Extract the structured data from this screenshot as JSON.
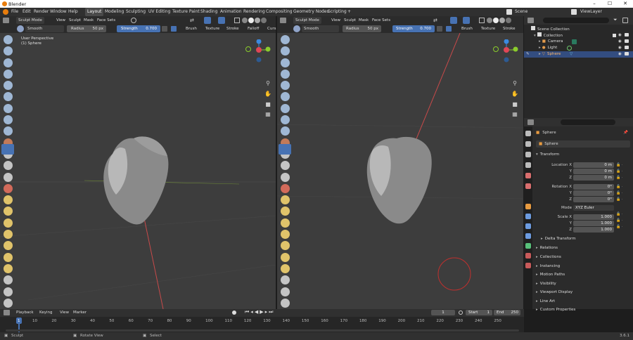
{
  "window": {
    "title": "Blender",
    "minimize": "–",
    "maximize": "☐",
    "close": "✕"
  },
  "menu": [
    "File",
    "Edit",
    "Render",
    "Window",
    "Help"
  ],
  "workspaces": [
    "Layout",
    "Modeling",
    "Sculpting",
    "UV Editing",
    "Texture Paint",
    "Shading",
    "Animation",
    "Rendering",
    "Compositing",
    "Geometry Nodes",
    "Scripting",
    "+"
  ],
  "active_workspace": "Layout",
  "scene": {
    "label": "Scene",
    "viewlayer": "ViewLayer"
  },
  "viewport_left": {
    "mode": "Sculpt Mode",
    "menus": [
      "View",
      "Sculpt",
      "Mask",
      "Face Sets"
    ],
    "brush_name": "Smooth",
    "radius_label": "Radius",
    "radius_value": "50 px",
    "strength_label": "Strength",
    "strength_value": "0.700",
    "dropdowns": [
      "Brush",
      "Texture",
      "Stroke",
      "Falloff",
      "Curs"
    ],
    "info_line1": "User Perspective",
    "info_line2": "(1) Sphere"
  },
  "viewport_right": {
    "mode": "Sculpt Mode",
    "menus": [
      "View",
      "Sculpt",
      "Mask",
      "Face Sets"
    ],
    "brush_name": "Smooth",
    "radius_label": "Radius",
    "radius_value": "50 px",
    "strength_label": "Strength",
    "strength_value": "0.700",
    "dropdowns": [
      "Brush",
      "Texture",
      "Stroke"
    ]
  },
  "gizmo": {
    "x": "X",
    "y": "Y",
    "z": "Z"
  },
  "outliner": {
    "search_placeholder": "",
    "items": [
      {
        "label": "Scene Collection",
        "depth": 0
      },
      {
        "label": "Collection",
        "depth": 1
      },
      {
        "label": "Camera",
        "depth": 2
      },
      {
        "label": "Light",
        "depth": 2
      },
      {
        "label": "Sphere",
        "depth": 2,
        "selected": true
      }
    ]
  },
  "properties": {
    "object_name": "Sphere",
    "data_name": "Sphere",
    "transform_label": "Transform",
    "location_label": "Location X",
    "location": [
      "0 m",
      "0 m",
      "0 m"
    ],
    "rotation_label": "Rotation X",
    "rotation": [
      "0°",
      "0°",
      "0°"
    ],
    "mode_label": "Mode",
    "mode_value": "XYZ Euler",
    "scale_label": "Scale X",
    "scale": [
      "1.000",
      "1.000",
      "1.000"
    ],
    "axis_y": "Y",
    "axis_z": "Z",
    "panels": [
      "Delta Transform",
      "Relations",
      "Collections",
      "Instancing",
      "Motion Paths",
      "Visibility",
      "Viewport Display",
      "Line Art",
      "Custom Properties"
    ]
  },
  "timeline": {
    "menus": [
      "Playback",
      "Keying",
      "View",
      "Marker"
    ],
    "current_frame": "1",
    "start_label": "Start",
    "start": "1",
    "end_label": "End",
    "end": "250",
    "ticks": [
      "1",
      "10",
      "20",
      "30",
      "40",
      "50",
      "60",
      "70",
      "80",
      "90",
      "100",
      "110",
      "120",
      "130",
      "140",
      "150",
      "160",
      "170",
      "180",
      "190",
      "200",
      "210",
      "220",
      "230",
      "240",
      "250"
    ]
  },
  "status": {
    "left": "Sculpt",
    "mid": "Rotate View",
    "right": "Select",
    "version": "3.6.1"
  },
  "colors": {
    "accent": "#4772b3",
    "header": "#303030",
    "viewport": "#3d3d3d",
    "axis_x": "#e04656",
    "axis_y": "#8bcc2c",
    "axis_z": "#3b8ae0",
    "brush_circle": "#c0302e"
  }
}
